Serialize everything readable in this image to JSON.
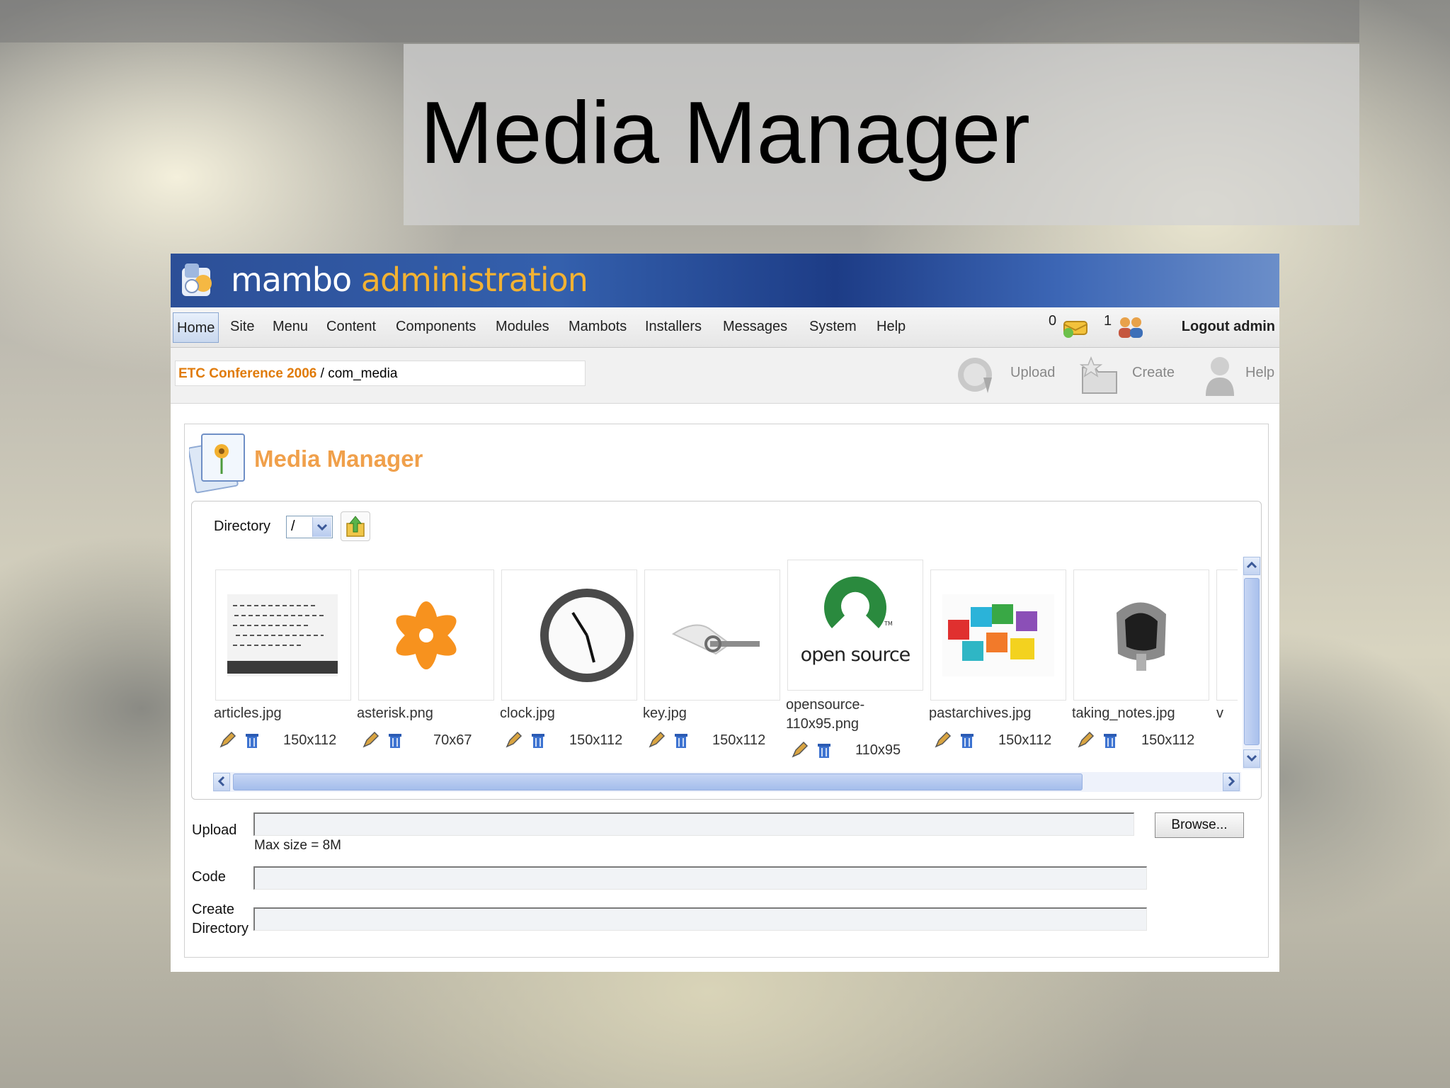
{
  "slide": {
    "title": "Media Manager"
  },
  "banner": {
    "word1": "mambo",
    "word2": "administration"
  },
  "menu": {
    "items": [
      "Home",
      "Site",
      "Menu",
      "Content",
      "Components",
      "Modules",
      "Mambots",
      "Installers",
      "Messages",
      "System",
      "Help"
    ],
    "messages_count": "0",
    "users_count": "1",
    "logout": "Logout admin"
  },
  "toolbar": {
    "site_name": "ETC Conference 2006",
    "path": " / com_media",
    "upload_label": "Upload",
    "create_label": "Create",
    "help_label": "Help"
  },
  "page": {
    "heading": "Media Manager"
  },
  "directory": {
    "label": "Directory",
    "value": "/"
  },
  "files": [
    {
      "name": "articles.jpg",
      "dims": "150x112"
    },
    {
      "name": "asterisk.png",
      "dims": "70x67"
    },
    {
      "name": "clock.jpg",
      "dims": "150x112"
    },
    {
      "name": "key.jpg",
      "dims": "150x112"
    },
    {
      "name": "opensource-\n110x95.png",
      "dims": "110x95"
    },
    {
      "name": "pastarchives.jpg",
      "dims": "150x112"
    },
    {
      "name": "taking_notes.jpg",
      "dims": "150x112"
    }
  ],
  "partial_next_file": "v",
  "opensource_logo_text": "open source",
  "form": {
    "upload_label": "Upload",
    "browse_label": "Browse...",
    "max_size": "Max size = 8M",
    "code_label": "Code",
    "create_dir_label": "Create\nDirectory"
  },
  "colors": {
    "accent_orange": "#f0a04b",
    "banner_blue": "#2c4f97",
    "site_orange": "#e07b0a"
  }
}
